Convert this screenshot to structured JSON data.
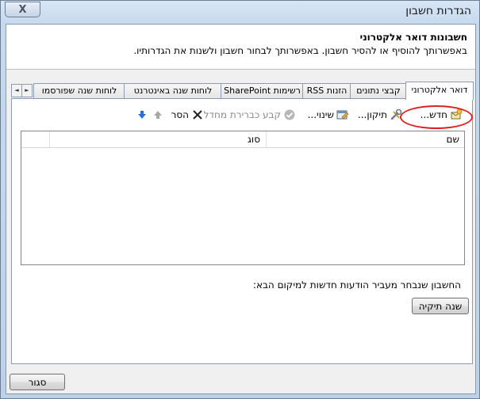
{
  "window": {
    "title": "הגדרות חשבון",
    "close_symbol": "X"
  },
  "header": {
    "title": "חשבונות דואר אלקטרוני",
    "description": "באפשרותך להוסיף או להסיר חשבון. באפשרותך לבחור חשבון ולשנות את הגדרותיו."
  },
  "tabs": [
    {
      "label": "דואר אלקטרוני",
      "active": true
    },
    {
      "label": "קבצי נתונים",
      "active": false
    },
    {
      "label": "הזנות RSS",
      "active": false
    },
    {
      "label": "רשימות SharePoint",
      "active": false
    },
    {
      "label": "לוחות שנה באינטרנט",
      "active": false
    },
    {
      "label": "לוחות שנה שפורסמו",
      "active": false
    }
  ],
  "tab_scroll": {
    "left": "◄",
    "right": "►"
  },
  "toolbar": {
    "new_label": "חדש...",
    "repair_label": "תיקון...",
    "change_label": "שינוי...",
    "set_default_label": "קבע כברירת מחדל",
    "remove_label": "הסר"
  },
  "list": {
    "col_name": "שם",
    "col_type": "סוג"
  },
  "delivery": {
    "text": "החשבון שנבחר מעביר הודעות חדשות למיקום הבא:",
    "change_folder_label": "שנה תיקיה"
  },
  "footer": {
    "close_label": "סגור"
  },
  "colors": {
    "highlight": "#e02020",
    "accent": "#2a6fd6"
  }
}
